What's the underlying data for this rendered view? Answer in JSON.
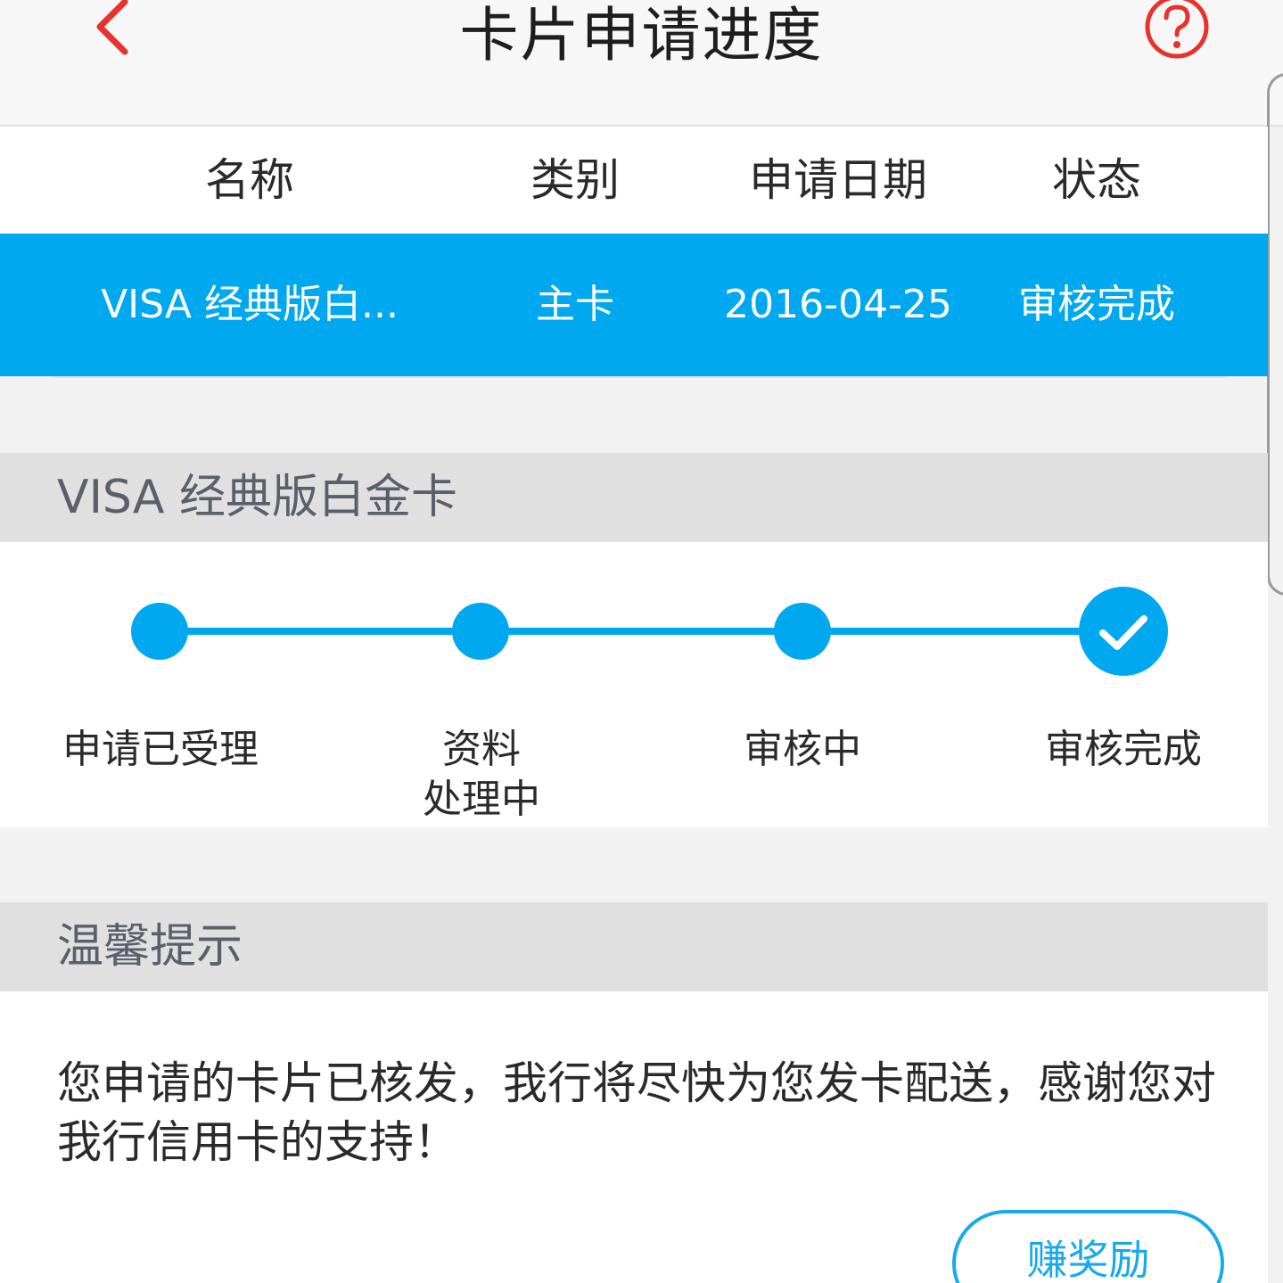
{
  "header": {
    "title": "卡片申请进度",
    "back_icon": "chevron-left-icon",
    "help_icon": "question-circle-icon"
  },
  "table": {
    "columns": [
      "名称",
      "类别",
      "申请日期",
      "状态"
    ],
    "rows": [
      {
        "name": "VISA 经典版白...",
        "type": "主卡",
        "date": "2016-04-25",
        "status": "审核完成"
      }
    ]
  },
  "card_section": {
    "title": "VISA 经典版白金卡",
    "steps": [
      "申请已受理",
      "资料\n处理中",
      "审核中",
      "审核完成"
    ]
  },
  "tips_section": {
    "title": "温馨提示",
    "message": "您申请的卡片已核发，我行将尽快为您发卡配送，感谢您对我行信用卡的支持！",
    "reward_button": "赚奖励"
  },
  "colors": {
    "accent": "#00a8ef",
    "back_icon": "#e8322c",
    "section_bg": "#e0e0e0"
  }
}
